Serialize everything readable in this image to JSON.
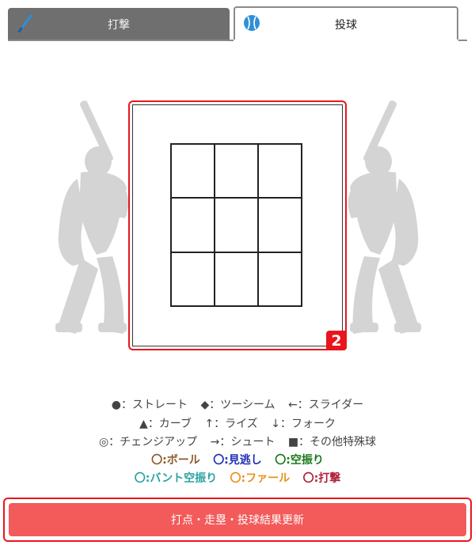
{
  "tabs": {
    "batting_label": "打撃",
    "pitching_label": "投球"
  },
  "zone": {
    "badge": "2"
  },
  "legend": {
    "row1": [
      {
        "symbol": "●",
        "label": "：ストレート"
      },
      {
        "symbol": "◆",
        "label": "：ツーシーム"
      },
      {
        "symbol": "←",
        "label": "：スライダー"
      }
    ],
    "row2": [
      {
        "symbol": "▲",
        "label": "：カーブ"
      },
      {
        "symbol": "↑",
        "label": "：ライズ"
      },
      {
        "symbol": "↓",
        "label": "：フォーク"
      }
    ],
    "row3": [
      {
        "symbol": "◎",
        "label": "：チェンジアップ"
      },
      {
        "symbol": "→",
        "label": "：シュート"
      },
      {
        "symbol": "■",
        "label": "：その他特殊球"
      }
    ]
  },
  "results": {
    "row1": [
      {
        "text": "〇:ボール",
        "color": "#8b5a2b"
      },
      {
        "text": "〇:見逃し",
        "color": "#1f2fb5"
      },
      {
        "text": "〇:空振り",
        "color": "#1a7a1a"
      }
    ],
    "row2": [
      {
        "text": "〇:バント空振り",
        "color": "#2aa3a3"
      },
      {
        "text": "〇:ファール",
        "color": "#e8901a"
      },
      {
        "text": "〇:打撃",
        "color": "#b0203a"
      }
    ]
  },
  "update_button": {
    "label": "打点・走塁・投球結果更新"
  },
  "colors": {
    "accent_red": "#e8161c",
    "button_bg": "#f35a5a",
    "tab_inactive": "#6f6f6f",
    "silhouette": "#d4d4d4"
  }
}
